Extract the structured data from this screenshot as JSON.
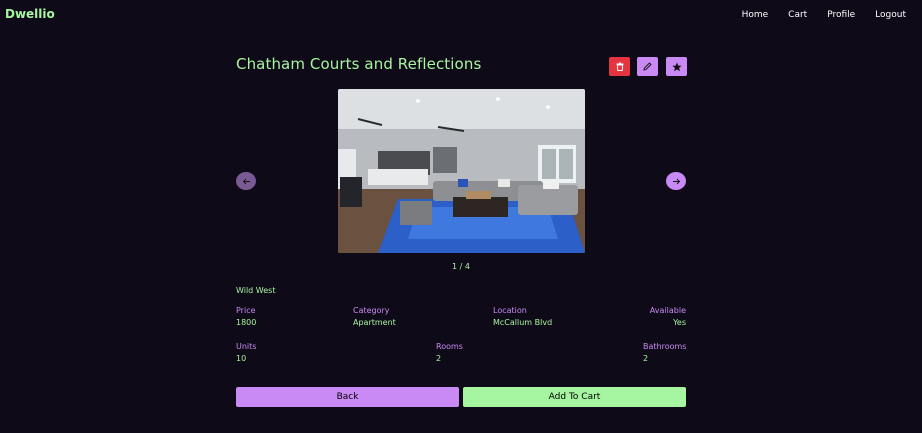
{
  "nav": {
    "brand": "Dwellio",
    "links": [
      "Home",
      "Cart",
      "Profile",
      "Logout"
    ]
  },
  "listing": {
    "title": "Chatham Courts and Reflections",
    "image_counter": "1 / 4",
    "area": "Wild West",
    "price_label": "Price",
    "price": "1800",
    "category_label": "Category",
    "category": "Apartment",
    "location_label": "Location",
    "location": "McCallum Blvd",
    "available_label": "Available",
    "available": "Yes",
    "units_label": "Units",
    "units": "10",
    "rooms_label": "Rooms",
    "rooms": "2",
    "bathrooms_label": "Bathrooms",
    "bathrooms": "2"
  },
  "buttons": {
    "back": "Back",
    "add_to_cart": "Add To Cart"
  },
  "icons": {
    "delete": "trash-icon",
    "edit": "pencil-icon",
    "favorite": "star-icon",
    "prev": "arrow-left-icon",
    "next": "arrow-right-icon"
  },
  "colors": {
    "background": "#0f0a17",
    "green_accent": "#a6f5a0",
    "purple_accent": "#c98af5",
    "danger": "#e3343f"
  }
}
